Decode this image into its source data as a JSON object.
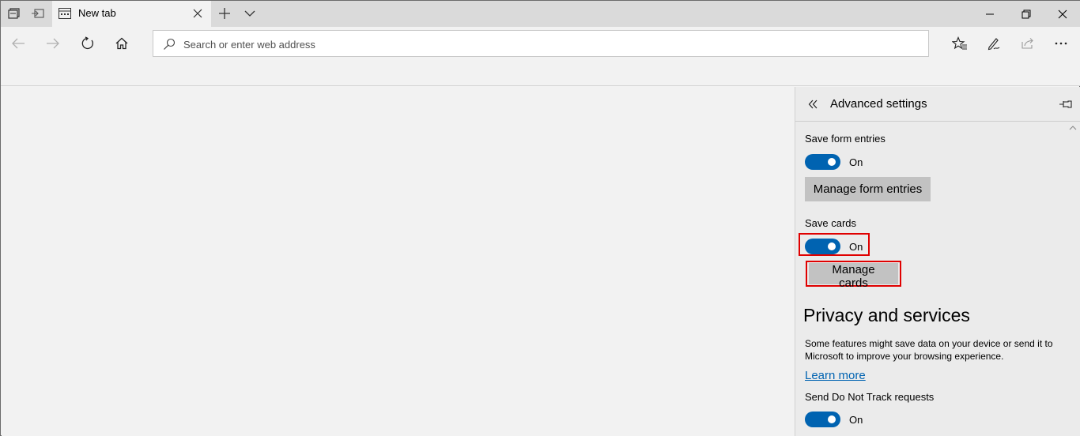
{
  "titlebar": {
    "tab": {
      "title": "New tab"
    }
  },
  "navbar": {
    "address_placeholder": "Search or enter web address"
  },
  "panel": {
    "title": "Advanced settings",
    "save_form_entries": {
      "label": "Save form entries",
      "toggle_state": "On",
      "button_label": "Manage form entries"
    },
    "save_cards": {
      "label": "Save cards",
      "toggle_state": "On",
      "button_label": "Manage cards"
    },
    "privacy": {
      "heading": "Privacy and services",
      "description": "Some features might save data on your device or send it to Microsoft to improve your browsing experience.",
      "learn_more": "Learn more"
    },
    "do_not_track": {
      "label": "Send Do Not Track requests",
      "toggle_state": "On"
    }
  },
  "colors": {
    "accent": "#0063b1",
    "highlight": "#e00000",
    "button_gray": "#c2c2c2"
  },
  "icons": [
    "set-aside-tabs-icon",
    "tabs-aside-icon",
    "tab-favicon-icon",
    "close-icon",
    "new-tab-icon",
    "chevron-down-icon",
    "minimize-icon",
    "restore-icon",
    "window-close-icon",
    "back-icon",
    "forward-icon",
    "refresh-icon",
    "home-icon",
    "search-icon",
    "favorites-icon",
    "notes-icon",
    "share-icon",
    "double-chevron-left-icon",
    "pin-icon",
    "scroll-up-icon"
  ]
}
